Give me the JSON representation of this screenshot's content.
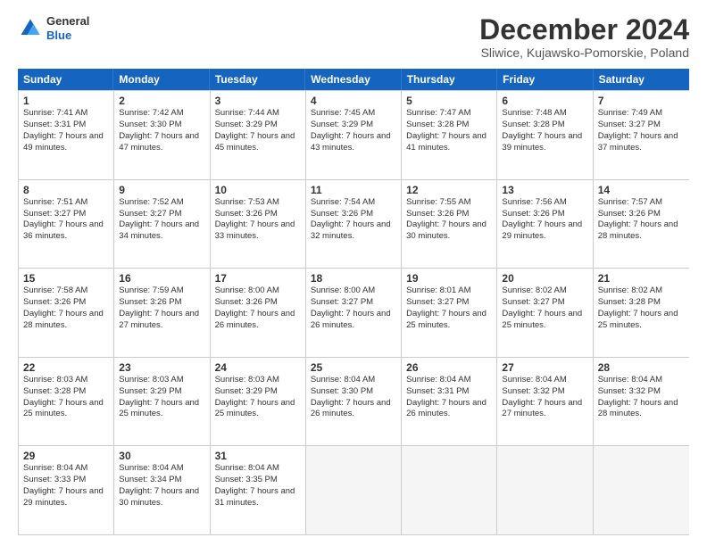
{
  "header": {
    "logo_general": "General",
    "logo_blue": "Blue",
    "title": "December 2024",
    "location": "Sliwice, Kujawsko-Pomorskie, Poland"
  },
  "days_of_week": [
    "Sunday",
    "Monday",
    "Tuesday",
    "Wednesday",
    "Thursday",
    "Friday",
    "Saturday"
  ],
  "weeks": [
    [
      {
        "day": "1",
        "rise": "Sunrise: 7:41 AM",
        "set": "Sunset: 3:31 PM",
        "daylight": "Daylight: 7 hours and 49 minutes."
      },
      {
        "day": "2",
        "rise": "Sunrise: 7:42 AM",
        "set": "Sunset: 3:30 PM",
        "daylight": "Daylight: 7 hours and 47 minutes."
      },
      {
        "day": "3",
        "rise": "Sunrise: 7:44 AM",
        "set": "Sunset: 3:29 PM",
        "daylight": "Daylight: 7 hours and 45 minutes."
      },
      {
        "day": "4",
        "rise": "Sunrise: 7:45 AM",
        "set": "Sunset: 3:29 PM",
        "daylight": "Daylight: 7 hours and 43 minutes."
      },
      {
        "day": "5",
        "rise": "Sunrise: 7:47 AM",
        "set": "Sunset: 3:28 PM",
        "daylight": "Daylight: 7 hours and 41 minutes."
      },
      {
        "day": "6",
        "rise": "Sunrise: 7:48 AM",
        "set": "Sunset: 3:28 PM",
        "daylight": "Daylight: 7 hours and 39 minutes."
      },
      {
        "day": "7",
        "rise": "Sunrise: 7:49 AM",
        "set": "Sunset: 3:27 PM",
        "daylight": "Daylight: 7 hours and 37 minutes."
      }
    ],
    [
      {
        "day": "8",
        "rise": "Sunrise: 7:51 AM",
        "set": "Sunset: 3:27 PM",
        "daylight": "Daylight: 7 hours and 36 minutes."
      },
      {
        "day": "9",
        "rise": "Sunrise: 7:52 AM",
        "set": "Sunset: 3:27 PM",
        "daylight": "Daylight: 7 hours and 34 minutes."
      },
      {
        "day": "10",
        "rise": "Sunrise: 7:53 AM",
        "set": "Sunset: 3:26 PM",
        "daylight": "Daylight: 7 hours and 33 minutes."
      },
      {
        "day": "11",
        "rise": "Sunrise: 7:54 AM",
        "set": "Sunset: 3:26 PM",
        "daylight": "Daylight: 7 hours and 32 minutes."
      },
      {
        "day": "12",
        "rise": "Sunrise: 7:55 AM",
        "set": "Sunset: 3:26 PM",
        "daylight": "Daylight: 7 hours and 30 minutes."
      },
      {
        "day": "13",
        "rise": "Sunrise: 7:56 AM",
        "set": "Sunset: 3:26 PM",
        "daylight": "Daylight: 7 hours and 29 minutes."
      },
      {
        "day": "14",
        "rise": "Sunrise: 7:57 AM",
        "set": "Sunset: 3:26 PM",
        "daylight": "Daylight: 7 hours and 28 minutes."
      }
    ],
    [
      {
        "day": "15",
        "rise": "Sunrise: 7:58 AM",
        "set": "Sunset: 3:26 PM",
        "daylight": "Daylight: 7 hours and 28 minutes."
      },
      {
        "day": "16",
        "rise": "Sunrise: 7:59 AM",
        "set": "Sunset: 3:26 PM",
        "daylight": "Daylight: 7 hours and 27 minutes."
      },
      {
        "day": "17",
        "rise": "Sunrise: 8:00 AM",
        "set": "Sunset: 3:26 PM",
        "daylight": "Daylight: 7 hours and 26 minutes."
      },
      {
        "day": "18",
        "rise": "Sunrise: 8:00 AM",
        "set": "Sunset: 3:27 PM",
        "daylight": "Daylight: 7 hours and 26 minutes."
      },
      {
        "day": "19",
        "rise": "Sunrise: 8:01 AM",
        "set": "Sunset: 3:27 PM",
        "daylight": "Daylight: 7 hours and 25 minutes."
      },
      {
        "day": "20",
        "rise": "Sunrise: 8:02 AM",
        "set": "Sunset: 3:27 PM",
        "daylight": "Daylight: 7 hours and 25 minutes."
      },
      {
        "day": "21",
        "rise": "Sunrise: 8:02 AM",
        "set": "Sunset: 3:28 PM",
        "daylight": "Daylight: 7 hours and 25 minutes."
      }
    ],
    [
      {
        "day": "22",
        "rise": "Sunrise: 8:03 AM",
        "set": "Sunset: 3:28 PM",
        "daylight": "Daylight: 7 hours and 25 minutes."
      },
      {
        "day": "23",
        "rise": "Sunrise: 8:03 AM",
        "set": "Sunset: 3:29 PM",
        "daylight": "Daylight: 7 hours and 25 minutes."
      },
      {
        "day": "24",
        "rise": "Sunrise: 8:03 AM",
        "set": "Sunset: 3:29 PM",
        "daylight": "Daylight: 7 hours and 25 minutes."
      },
      {
        "day": "25",
        "rise": "Sunrise: 8:04 AM",
        "set": "Sunset: 3:30 PM",
        "daylight": "Daylight: 7 hours and 26 minutes."
      },
      {
        "day": "26",
        "rise": "Sunrise: 8:04 AM",
        "set": "Sunset: 3:31 PM",
        "daylight": "Daylight: 7 hours and 26 minutes."
      },
      {
        "day": "27",
        "rise": "Sunrise: 8:04 AM",
        "set": "Sunset: 3:32 PM",
        "daylight": "Daylight: 7 hours and 27 minutes."
      },
      {
        "day": "28",
        "rise": "Sunrise: 8:04 AM",
        "set": "Sunset: 3:32 PM",
        "daylight": "Daylight: 7 hours and 28 minutes."
      }
    ],
    [
      {
        "day": "29",
        "rise": "Sunrise: 8:04 AM",
        "set": "Sunset: 3:33 PM",
        "daylight": "Daylight: 7 hours and 29 minutes."
      },
      {
        "day": "30",
        "rise": "Sunrise: 8:04 AM",
        "set": "Sunset: 3:34 PM",
        "daylight": "Daylight: 7 hours and 30 minutes."
      },
      {
        "day": "31",
        "rise": "Sunrise: 8:04 AM",
        "set": "Sunset: 3:35 PM",
        "daylight": "Daylight: 7 hours and 31 minutes."
      },
      null,
      null,
      null,
      null
    ]
  ]
}
